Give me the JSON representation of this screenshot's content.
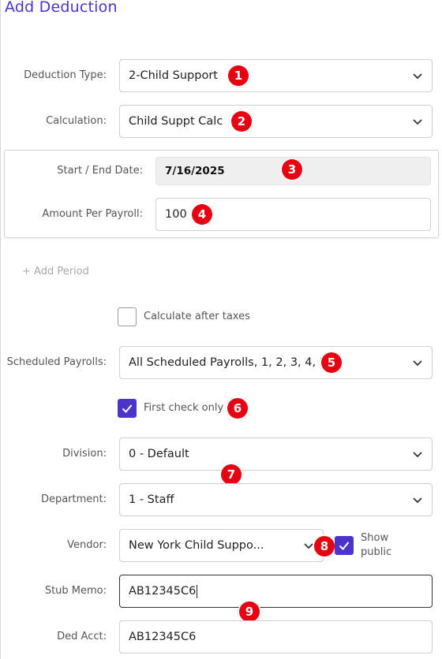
{
  "page": {
    "title": "Add Deduction"
  },
  "deduction_type": {
    "label": "Deduction Type:",
    "value": "2-Child Support"
  },
  "calculation": {
    "label": "Calculation:",
    "value": "Child Suppt Calc"
  },
  "period": {
    "start_end_label": "Start / End Date:",
    "start_end_value": "7/16/2025",
    "amount_label": "Amount Per Payroll:",
    "amount_value": "100"
  },
  "add_period": {
    "label": "+ Add Period"
  },
  "calc_after_taxes": {
    "label": "Calculate after taxes",
    "checked": false
  },
  "scheduled_payrolls": {
    "label": "Scheduled Payrolls:",
    "value": "All Scheduled Payrolls, 1, 2, 3, 4, 5"
  },
  "first_check_only": {
    "label": "First check only",
    "checked": true
  },
  "division": {
    "label": "Division:",
    "value": "0 - Default"
  },
  "department": {
    "label": "Department:",
    "value": "1 - Staff"
  },
  "vendor": {
    "label": "Vendor:",
    "value": "New York Child Suppo...",
    "show_public_label_1": "Show",
    "show_public_label_2": "public",
    "show_public_checked": true
  },
  "stub_memo": {
    "label": "Stub Memo:",
    "value": "AB12345C6"
  },
  "ded_acct": {
    "label": "Ded Acct:",
    "value": "AB12345C6"
  },
  "badges": [
    "1",
    "2",
    "3",
    "4",
    "5",
    "6",
    "7",
    "8",
    "9"
  ],
  "colors": {
    "accent": "#4b34c9",
    "badge": "#e60012"
  }
}
